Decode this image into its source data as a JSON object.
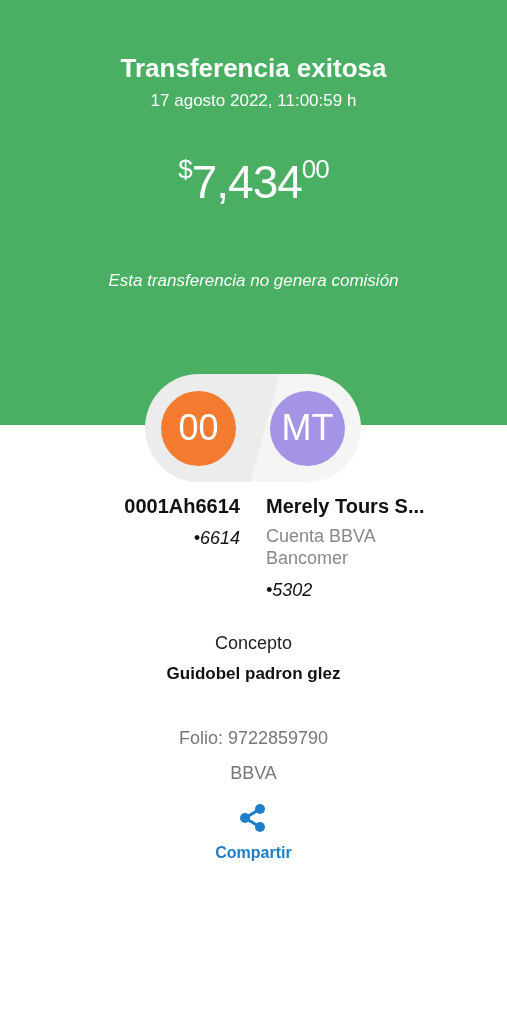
{
  "header": {
    "title": "Transferencia exitosa",
    "date": "17 agosto 2022, 11:00:59 h",
    "amount": {
      "currency": "$",
      "whole": "7,434",
      "cents": "00"
    },
    "note": "Esta transferencia no genera comisión"
  },
  "parties": [
    {
      "initials": "00",
      "color": "#f47b30",
      "name": "0001Ah6614",
      "account": "•6614"
    },
    {
      "initials": "MT",
      "color": "#a594e6",
      "name": "Merely Tours S...",
      "bank": "Cuenta BBVA Bancomer",
      "account": "•5302"
    }
  ],
  "concept": {
    "label": "Concepto",
    "value": "Guidobel padron glez"
  },
  "folio": "Folio: 9722859790",
  "bank": "BBVA",
  "share": {
    "label": "Compartir"
  }
}
